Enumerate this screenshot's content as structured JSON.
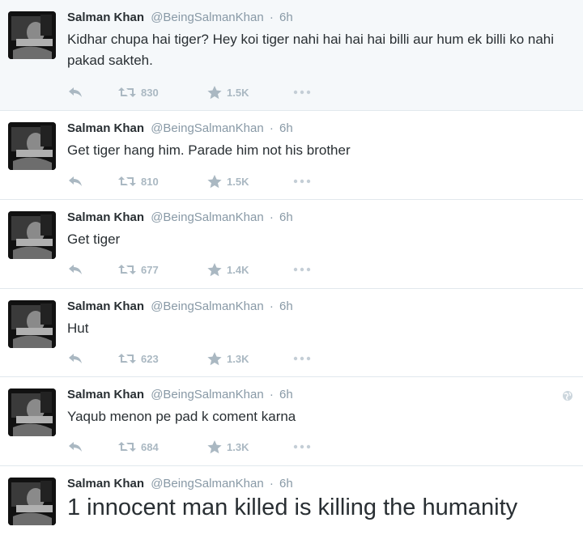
{
  "tweets": [
    {
      "name": "Salman Khan",
      "handle": "@BeingSalmanKhan",
      "sep": "·",
      "time": "6h",
      "text": "Kidhar chupa hai tiger? Hey koi tiger nahi hai hai hai billi aur hum ek billi ko nahi pakad sakteh.",
      "retweets": "830",
      "favorites": "1.5K",
      "highlighted": true
    },
    {
      "name": "Salman Khan",
      "handle": "@BeingSalmanKhan",
      "sep": "·",
      "time": "6h",
      "text": "Get tiger hang him. Parade him not his brother",
      "retweets": "810",
      "favorites": "1.5K"
    },
    {
      "name": "Salman Khan",
      "handle": "@BeingSalmanKhan",
      "sep": "·",
      "time": "6h",
      "text": "Get tiger",
      "retweets": "677",
      "favorites": "1.4K"
    },
    {
      "name": "Salman Khan",
      "handle": "@BeingSalmanKhan",
      "sep": "·",
      "time": "6h",
      "text": "Hut",
      "retweets": "623",
      "favorites": "1.3K"
    },
    {
      "name": "Salman Khan",
      "handle": "@BeingSalmanKhan",
      "sep": "·",
      "time": "6h",
      "text": "Yaqub menon pe pad k coment karna",
      "retweets": "684",
      "favorites": "1.3K",
      "has_globe_icon": true
    },
    {
      "name": "Salman Khan",
      "handle": "@BeingSalmanKhan",
      "sep": "·",
      "time": "6h",
      "text": "1 innocent man killed is killing the humanity",
      "large_text": true
    }
  ],
  "icons": {
    "reply": "reply-icon",
    "retweet": "retweet-icon",
    "favorite": "star-icon",
    "more": "more-dots-icon",
    "globe": "globe-icon"
  },
  "colors": {
    "name": "#292f33",
    "meta": "#8899a6",
    "action": "#aab8c2",
    "border": "#e1e8ed",
    "highlight_bg": "#f5f8fa"
  }
}
